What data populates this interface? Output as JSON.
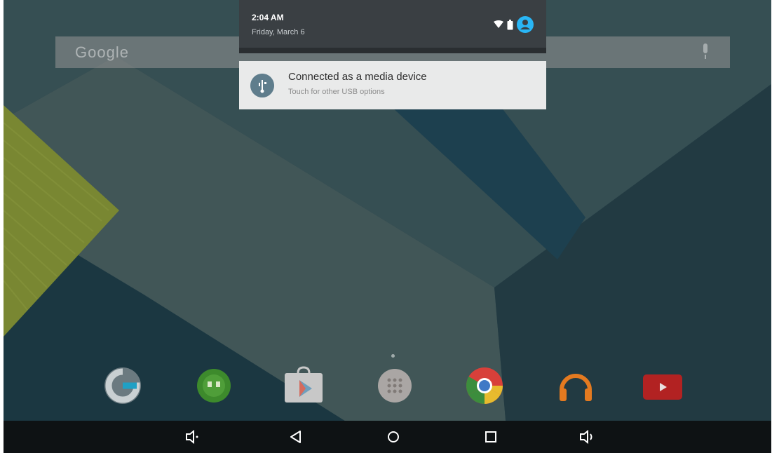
{
  "search": {
    "logo_text": "Google",
    "mic_icon": "mic-icon"
  },
  "shade": {
    "time": "2:04 AM",
    "date": "Friday, March 6",
    "status_icons": [
      "wifi-icon",
      "battery-icon",
      "user-account-icon"
    ],
    "accent": "#29b6f6"
  },
  "notification": {
    "icon": "usb-icon",
    "title": "Connected as a media device",
    "subtitle": "Touch for other USB options"
  },
  "dock": {
    "apps": [
      {
        "name": "google-app-icon"
      },
      {
        "name": "hangouts-icon"
      },
      {
        "name": "play-store-icon"
      },
      {
        "name": "app-drawer-icon"
      },
      {
        "name": "chrome-icon"
      },
      {
        "name": "play-music-icon"
      },
      {
        "name": "youtube-icon"
      }
    ]
  },
  "navbar": {
    "buttons": [
      "volume-down-icon",
      "back-icon",
      "home-icon",
      "recents-icon",
      "volume-up-icon"
    ]
  },
  "colors": {
    "wallpaper_base": "#2f4b54",
    "shade_bg": "#3a3f43",
    "notification_bg": "#e9eaea",
    "navbar_bg": "#0e1214"
  }
}
